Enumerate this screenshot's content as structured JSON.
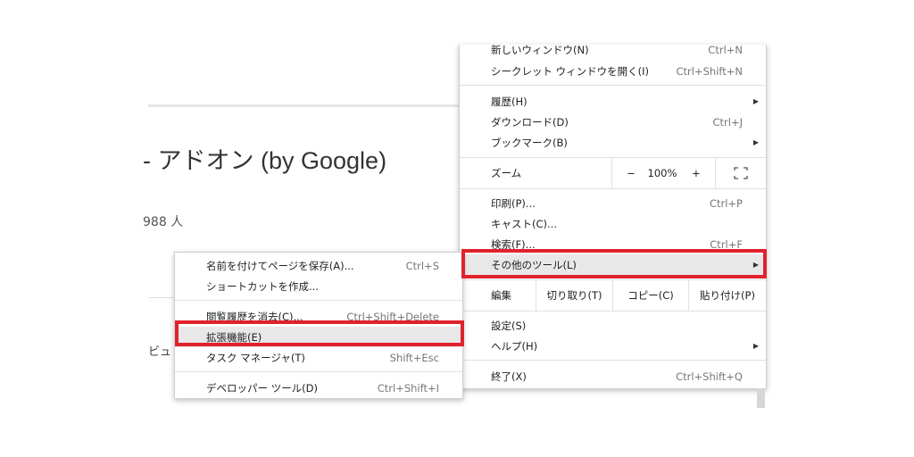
{
  "background": {
    "title": "- アドオン (by Google)",
    "users": "988 人",
    "review_fragment": "ビュ"
  },
  "main_menu": {
    "new_window": {
      "label": "新しいウィンドウ(N)",
      "shortcut": "Ctrl+N"
    },
    "incognito": {
      "label": "シークレット ウィンドウを開く(I)",
      "shortcut": "Ctrl+Shift+N"
    },
    "history": {
      "label": "履歴(H)"
    },
    "downloads": {
      "label": "ダウンロード(D)",
      "shortcut": "Ctrl+J"
    },
    "bookmarks": {
      "label": "ブックマーク(B)"
    },
    "zoom": {
      "label": "ズーム",
      "minus": "−",
      "value": "100%",
      "plus": "+"
    },
    "print": {
      "label": "印刷(P)...",
      "shortcut": "Ctrl+P"
    },
    "cast": {
      "label": "キャスト(C)..."
    },
    "find": {
      "label": "検索(F)...",
      "shortcut": "Ctrl+F"
    },
    "more_tools": {
      "label": "その他のツール(L)"
    },
    "edit": {
      "label": "編集",
      "cut": "切り取り(T)",
      "copy": "コピー(C)",
      "paste": "貼り付け(P)"
    },
    "settings": {
      "label": "設定(S)"
    },
    "help": {
      "label": "ヘルプ(H)"
    },
    "exit": {
      "label": "終了(X)",
      "shortcut": "Ctrl+Shift+Q"
    }
  },
  "sub_menu": {
    "save_page": {
      "label": "名前を付けてページを保存(A)...",
      "shortcut": "Ctrl+S"
    },
    "create_shortcut": {
      "label": "ショートカットを作成..."
    },
    "clear_data": {
      "label": "閲覧履歴を消去(C)...",
      "shortcut": "Ctrl+Shift+Delete"
    },
    "extensions": {
      "label": "拡張機能(E)"
    },
    "task_manager": {
      "label": "タスク マネージャ(T)",
      "shortcut": "Shift+Esc"
    },
    "dev_tools": {
      "label": "デベロッパー ツール(D)",
      "shortcut": "Ctrl+Shift+I"
    }
  },
  "highlight_color": "#e0222d"
}
